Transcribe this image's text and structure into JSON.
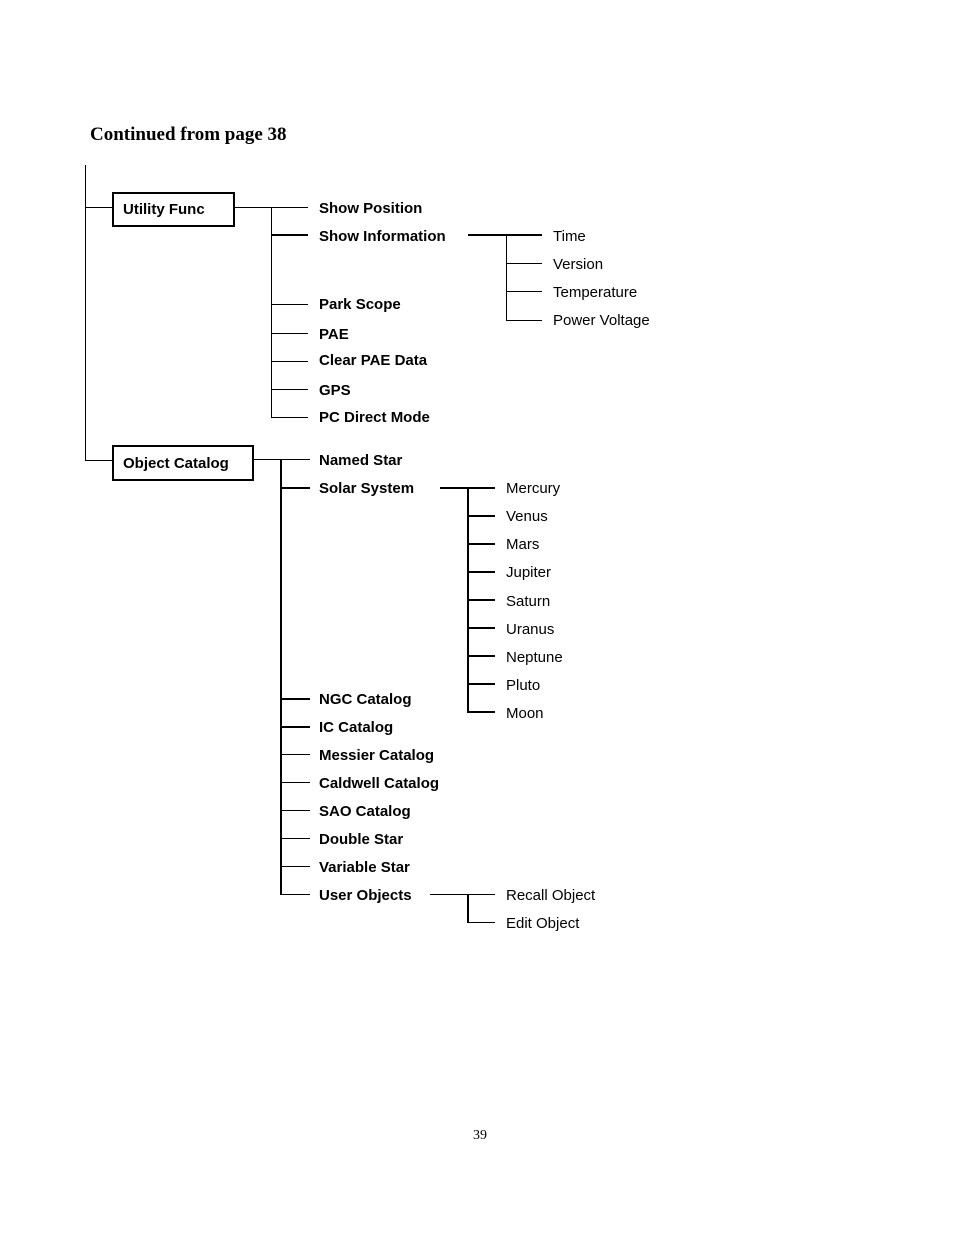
{
  "heading": "Continued from page 38",
  "page_number": "39",
  "tree": {
    "utility": {
      "label": "Utility Func",
      "items": [
        "Show Position",
        "Show Information",
        "Park Scope",
        "PAE",
        "Clear PAE Data",
        "GPS",
        "PC Direct Mode"
      ],
      "show_information_children": [
        "Time",
        "Version",
        "Temperature",
        "Power Voltage"
      ]
    },
    "catalog": {
      "label": "Object Catalog",
      "items": [
        "Named Star",
        "Solar System",
        "NGC Catalog",
        "IC Catalog",
        "Messier Catalog",
        "Caldwell Catalog",
        "SAO Catalog",
        "Double Star",
        "Variable Star",
        "User Objects"
      ],
      "solar_system_children": [
        "Mercury",
        "Venus",
        "Mars",
        "Jupiter",
        "Saturn",
        "Uranus",
        "Neptune",
        "Pluto",
        "Moon"
      ],
      "user_objects_children": [
        "Recall Object",
        "Edit Object"
      ]
    }
  }
}
